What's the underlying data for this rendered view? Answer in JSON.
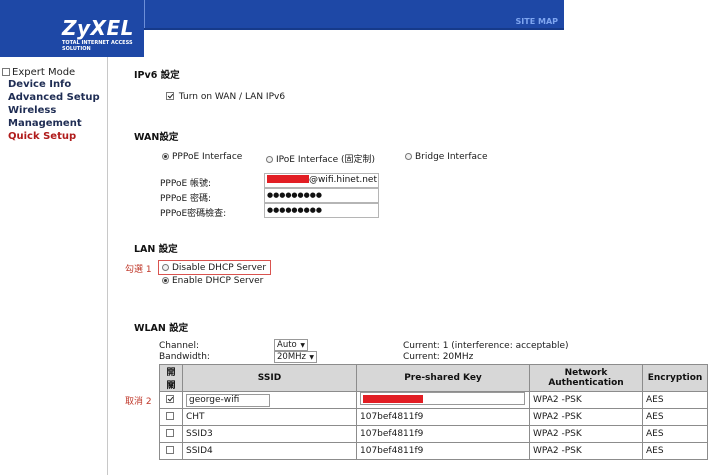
{
  "header": {
    "brand": "ZyXEL",
    "tagline": "TOTAL INTERNET ACCESS SOLUTION",
    "site_map": "SITE MAP"
  },
  "sidebar": {
    "mode": "Expert Mode",
    "items": [
      {
        "label": "Device Info"
      },
      {
        "label": "Advanced Setup"
      },
      {
        "label": "Wireless"
      },
      {
        "label": "Management"
      },
      {
        "label": "Quick Setup"
      }
    ]
  },
  "ipv6": {
    "title": "IPv6 設定",
    "checkbox_label": "Turn on WAN / LAN IPv6",
    "checked": true
  },
  "wan": {
    "title": "WAN設定",
    "options": [
      "PPPoE Interface",
      "IPoE Interface (固定制)",
      "Bridge Interface"
    ],
    "selected": "PPPoE Interface",
    "fields": [
      {
        "label": "PPPoE 帳號:",
        "value": "@wifi.hinet.net"
      },
      {
        "label": "PPPoE 密碼:",
        "value": "●●●●●●●●●"
      },
      {
        "label": "PPPoE密碼檢查:",
        "value": "●●●●●●●●●"
      }
    ]
  },
  "lan": {
    "title": "LAN 設定",
    "annotation": "勾選 1",
    "disable_dhcp": "Disable DHCP Server",
    "enable_dhcp": "Enable DHCP Server"
  },
  "wlan": {
    "title": "WLAN 設定",
    "channel_label": "Channel:",
    "channel_value": "Auto",
    "bandwidth_label": "Bandwidth:",
    "bandwidth_value": "20MHz",
    "current_channel": "Current: 1 (interference: acceptable)",
    "current_bandwidth": "Current: 20MHz",
    "annotation": "取消 2",
    "headers": [
      "開關",
      "SSID",
      "Pre-shared Key",
      "Network Authentication",
      "Encryption"
    ],
    "rows": [
      {
        "checked": true,
        "ssid": "george-wifi",
        "key": "",
        "auth": "WPA2 -PSK",
        "enc": "AES"
      },
      {
        "checked": false,
        "ssid": "CHT",
        "key": "107bef4811f9",
        "auth": "WPA2 -PSK",
        "enc": "AES"
      },
      {
        "checked": false,
        "ssid": "SSID3",
        "key": "107bef4811f9",
        "auth": "WPA2 -PSK",
        "enc": "AES"
      },
      {
        "checked": false,
        "ssid": "SSID4",
        "key": "107bef4811f9",
        "auth": "WPA2 -PSK",
        "enc": "AES"
      }
    ]
  },
  "colors": {
    "brand_blue": "#1e48a6",
    "nav_active": "#b01b1b",
    "annotation_red": "#c0392b",
    "redaction": "#e21e24"
  }
}
